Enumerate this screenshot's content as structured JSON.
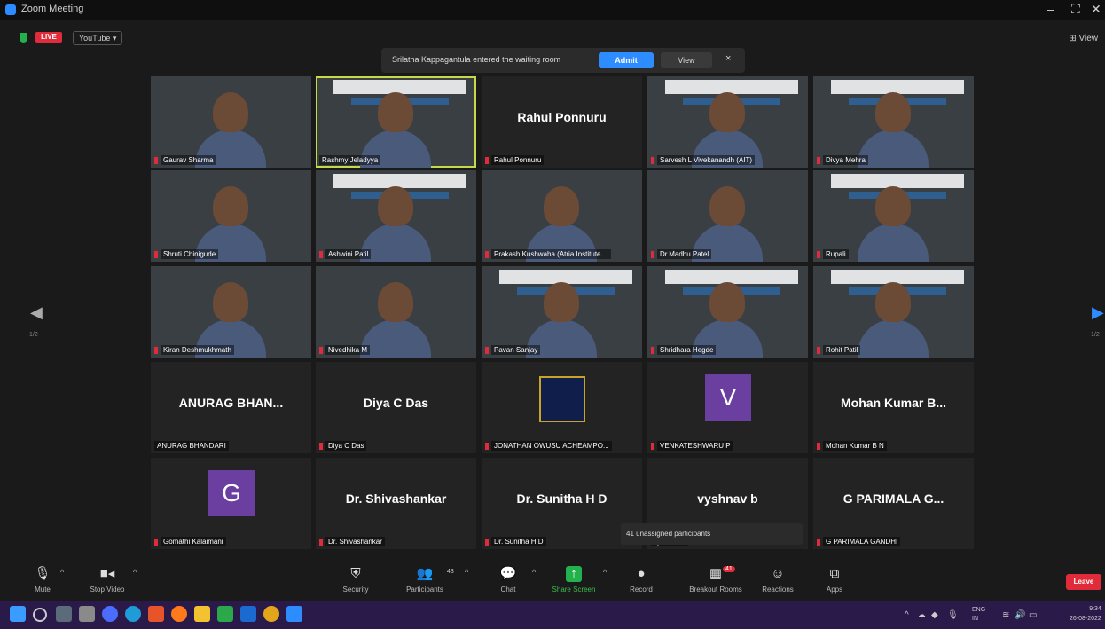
{
  "window": {
    "title": "Zoom Meeting",
    "minimize": "–",
    "maximize": "⛶",
    "close": "✕"
  },
  "status": {
    "live_label": "LIVE",
    "youtube_label": "YouTube ▾",
    "view_label": "⊞ View"
  },
  "notification": {
    "text": "Srilatha Kappagantula entered the waiting room",
    "admit_label": "Admit",
    "view_label": "View",
    "close": "×"
  },
  "tiles": [
    {
      "name": "Gaurav Sharma",
      "type": "video",
      "bg": "bg-a",
      "muted": true
    },
    {
      "name": "Rashmy Jeladyya",
      "type": "video",
      "bg": "bg-b",
      "muted": false,
      "active": true
    },
    {
      "name": "Rahul Ponnuru",
      "type": "name",
      "display": "Rahul Ponnuru",
      "muted": true
    },
    {
      "name": "Sarvesh L Vivekanandh (AIT)",
      "type": "video",
      "bg": "bg-b",
      "muted": true
    },
    {
      "name": "Divya Mehra",
      "type": "video",
      "bg": "bg-b",
      "muted": true
    },
    {
      "name": "Shruti Chinigude",
      "type": "video",
      "bg": "bg-d",
      "muted": true
    },
    {
      "name": "Ashwini Patil",
      "type": "video",
      "bg": "bg-b",
      "muted": true
    },
    {
      "name": "Prakash Kushwaha (Atria Institute ...",
      "type": "video",
      "bg": "bg-e",
      "muted": true
    },
    {
      "name": "Dr.Madhu Patel",
      "type": "video",
      "bg": "bg-f",
      "muted": true
    },
    {
      "name": "Rupali",
      "type": "video",
      "bg": "bg-b",
      "muted": true
    },
    {
      "name": "Kiran Deshmukhmath",
      "type": "video",
      "bg": "bg-c",
      "muted": true
    },
    {
      "name": "Nivedhika M",
      "type": "video",
      "bg": "bg-d",
      "muted": true
    },
    {
      "name": "Pavan Sanjay",
      "type": "video",
      "bg": "bg-b",
      "muted": true
    },
    {
      "name": "Shridhara Hegde",
      "type": "video",
      "bg": "bg-b",
      "muted": true
    },
    {
      "name": "Rohit Patil",
      "type": "video",
      "bg": "bg-b",
      "muted": true
    },
    {
      "name": "ANURAG BHANDARI",
      "type": "name",
      "display": "ANURAG BHAN...",
      "muted": false
    },
    {
      "name": "Diya C Das",
      "type": "name",
      "display": "Diya C Das",
      "muted": true
    },
    {
      "name": "JONATHAN OWUSU ACHEAMPO...",
      "type": "logo",
      "muted": true
    },
    {
      "name": "VENKATESHWARU P",
      "type": "avatar",
      "letter": "V",
      "color": "#6b3fa0",
      "muted": true
    },
    {
      "name": "Mohan Kumar B N",
      "type": "name",
      "display": "Mohan Kumar B...",
      "muted": true
    },
    {
      "name": "Gomathi Kalaimani",
      "type": "avatar",
      "letter": "G",
      "color": "#6b3fa0",
      "muted": true
    },
    {
      "name": "Dr. Shivashankar",
      "type": "name",
      "display": "Dr. Shivashankar",
      "muted": true
    },
    {
      "name": "Dr. Sunitha H D",
      "type": "name",
      "display": "Dr. Sunitha H D",
      "muted": true
    },
    {
      "name": "vyshnav b",
      "type": "name",
      "display": "vyshnav b",
      "muted": false
    },
    {
      "name": "G PARIMALA GANDHI",
      "type": "name",
      "display": "G PARIMALA G...",
      "muted": true
    }
  ],
  "page_indicator": {
    "left": "1/2",
    "right": "1/2"
  },
  "tooltip": "41 unassigned participants",
  "toolbar": {
    "mute": "Mute",
    "stop_video": "Stop Video",
    "security": "Security",
    "participants": "Participants",
    "participants_count": "43",
    "chat": "Chat",
    "share_screen": "Share Screen",
    "record": "Record",
    "breakout_rooms": "Breakout Rooms",
    "breakout_badge": "41",
    "reactions": "Reactions",
    "apps": "Apps",
    "leave": "Leave"
  },
  "taskbar": {
    "icons": [
      "windows-icon",
      "search-icon",
      "taskview-icon",
      "files-icon",
      "edge-icon",
      "chrome-icon",
      "office-icon",
      "firefox-icon",
      "explorer-icon",
      "store-icon",
      "outlook-icon",
      "chrome2-icon",
      "zoom-icon"
    ],
    "lang": "ENG\nIN",
    "time": "9:34",
    "date": "26-08-2022"
  },
  "colors": {
    "accent": "#2d8cff",
    "leave": "#e02b3a",
    "share": "#23b14d",
    "avatar": "#6b3fa0"
  }
}
